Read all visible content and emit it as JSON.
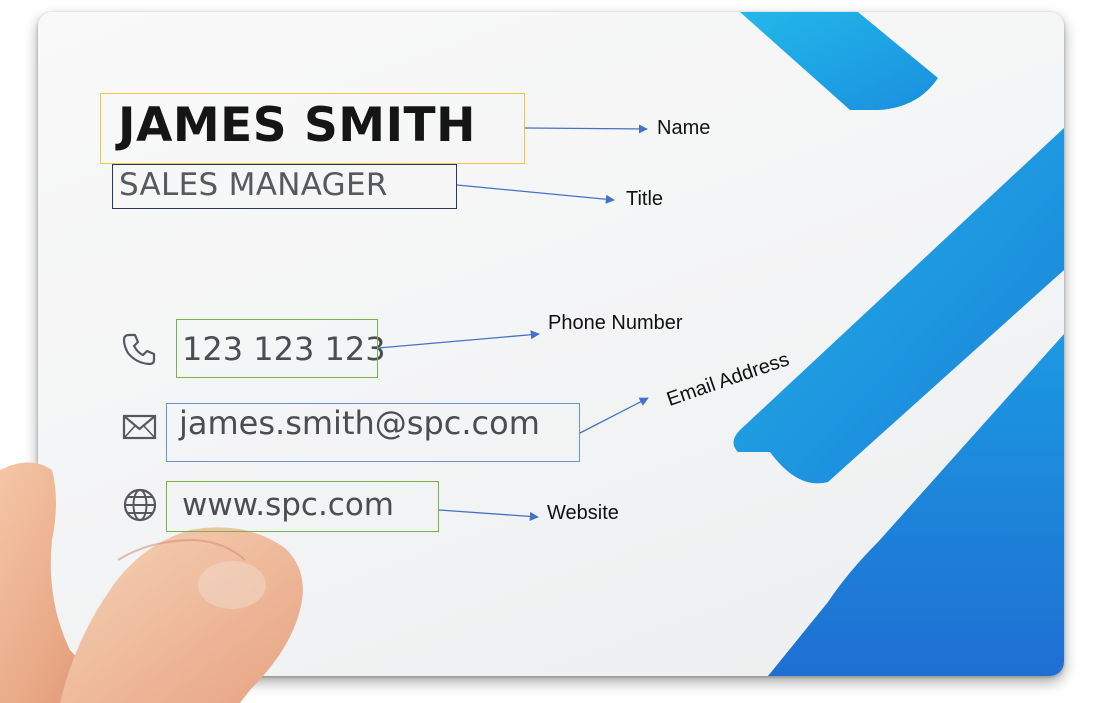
{
  "card": {
    "name": "JAMES SMITH",
    "title": "SALES MANAGER",
    "phone": "123 123 123",
    "email": "james.smith@spc.com",
    "website": "www.spc.com",
    "icons": {
      "phone": "phone-icon",
      "email": "mail-icon",
      "website": "globe-icon"
    },
    "colors": {
      "accent_light": "#1fb0e6",
      "accent_dark": "#1f7ed9",
      "card_background": "#f5f6f7"
    }
  },
  "annotations": {
    "name_label": "Name",
    "title_label": "Title",
    "phone_label": "Phone Number",
    "email_label": "Email Address",
    "website_label": "Website",
    "colors": {
      "name_box": "#f2c744",
      "title_box": "#27375e",
      "phone_box": "#79b14b",
      "email_box": "#6f90c9",
      "website_box": "#79b14b",
      "arrow": "#4472c4"
    }
  }
}
